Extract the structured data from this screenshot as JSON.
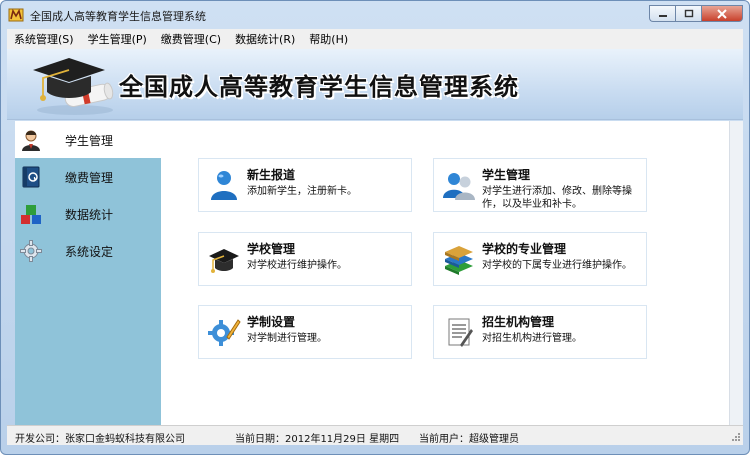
{
  "window": {
    "title": "全国成人高等教育学生信息管理系统"
  },
  "menu": [
    "系统管理(S)",
    "学生管理(P)",
    "缴费管理(C)",
    "数据统计(R)",
    "帮助(H)"
  ],
  "banner": {
    "title": "全国成人高等教育学生信息管理系统"
  },
  "sidebar": {
    "items": [
      {
        "label": "学生管理",
        "icon": "student-icon",
        "active": true
      },
      {
        "label": "缴费管理",
        "icon": "payment-book-icon",
        "active": false
      },
      {
        "label": "数据统计",
        "icon": "blocks-chart-icon",
        "active": false
      },
      {
        "label": "系统设定",
        "icon": "gear-icon",
        "active": false
      }
    ]
  },
  "cards": [
    {
      "title": "新生报道",
      "desc": "添加新学生，注册新卡。",
      "icon": "user-add-icon"
    },
    {
      "title": "学生管理",
      "desc": "对学生进行添加、修改、删除等操作，以及毕业和补卡。",
      "icon": "users-icon"
    },
    {
      "title": "学校管理",
      "desc": "对学校进行维护操作。",
      "icon": "graduation-cap-icon"
    },
    {
      "title": "学校的专业管理",
      "desc": "对学校的下属专业进行维护操作。",
      "icon": "books-icon"
    },
    {
      "title": "学制设置",
      "desc": "对学制进行管理。",
      "icon": "settings-edit-icon"
    },
    {
      "title": "招生机构管理",
      "desc": "对招生机构进行管理。",
      "icon": "document-edit-icon"
    }
  ],
  "status": {
    "company": "开发公司：张家口金蚂蚁科技有限公司",
    "date": "当前日期：2012年11月29日 星期四",
    "user": "当前用户：超级管理员"
  },
  "colors": {
    "sidebar": "#8fc3d9",
    "banner": "#c9dcf1",
    "close": "#c8402b"
  }
}
